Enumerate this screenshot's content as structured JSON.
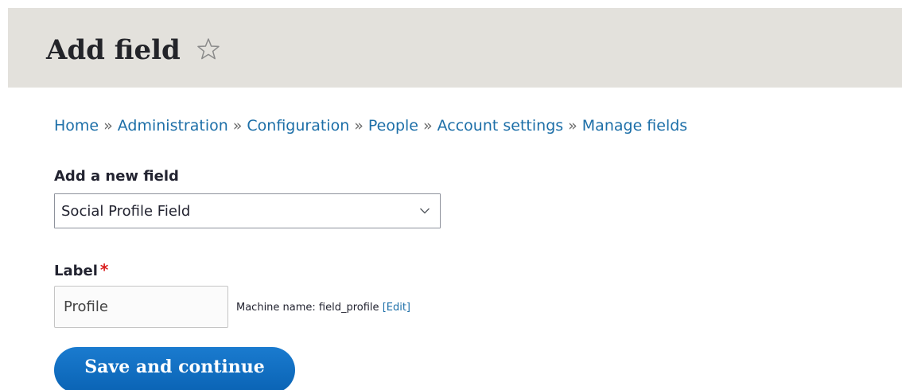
{
  "header": {
    "title": "Add field",
    "star_icon": "star-outline-icon"
  },
  "breadcrumb": {
    "items": [
      "Home",
      "Administration",
      "Configuration",
      "People",
      "Account settings",
      "Manage fields"
    ],
    "separator": "»"
  },
  "form": {
    "new_field": {
      "label": "Add a new field",
      "selected": "Social Profile Field",
      "chevron_icon": "chevron-down-icon"
    },
    "label_field": {
      "label": "Label",
      "required_mark": "*",
      "value": "Profile",
      "machine_name_prefix": "Machine name: field_profile",
      "edit_link": "[Edit]"
    },
    "submit_label": "Save and continue"
  },
  "colors": {
    "header_bg": "#e3e1dc",
    "link": "#1d6fa8",
    "button": "#0f6cbd",
    "required": "#d91f1f"
  }
}
